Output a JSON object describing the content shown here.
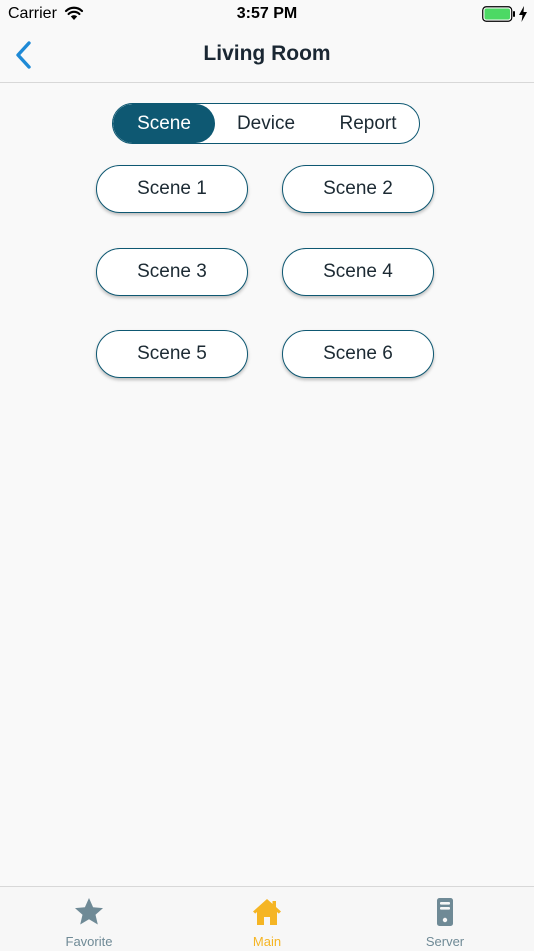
{
  "status_bar": {
    "carrier": "Carrier",
    "time": "3:57 PM",
    "icons": [
      "wifi-icon",
      "battery-icon",
      "charging-icon"
    ]
  },
  "nav": {
    "title": "Living Room",
    "back_icon": "chevron-left-icon"
  },
  "segments": [
    {
      "label": "Scene",
      "active": true
    },
    {
      "label": "Device",
      "active": false
    },
    {
      "label": "Report",
      "active": false
    }
  ],
  "scenes": [
    "Scene 1",
    "Scene 2",
    "Scene 3",
    "Scene 4",
    "Scene 5",
    "Scene 6"
  ],
  "tabs": [
    {
      "label": "Favorite",
      "icon": "star-icon",
      "active": false
    },
    {
      "label": "Main",
      "icon": "home-icon",
      "active": true
    },
    {
      "label": "Server",
      "icon": "server-icon",
      "active": false
    }
  ],
  "colors": {
    "accent": "#0e5872",
    "back": "#1f8ad6",
    "tab_active": "#f5b524",
    "tab_inactive": "#6f8a96",
    "battery": "#4cd964"
  }
}
